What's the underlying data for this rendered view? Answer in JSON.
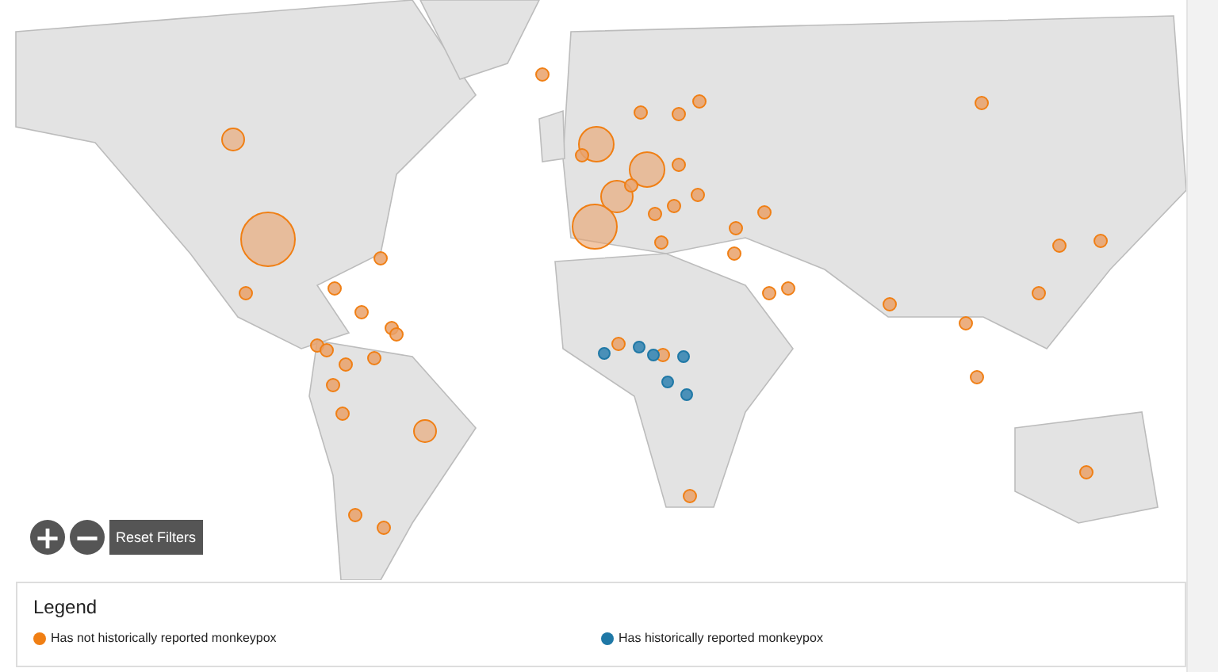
{
  "zoom_controls": [
    {
      "label": "+"
    },
    {
      "label": "−"
    }
  ],
  "reset_button": {
    "label": "Reset Filters"
  },
  "legend": {
    "title": "Legend",
    "items": [
      {
        "label": "Has not historically reported monkeypox",
        "color": "#f07f14"
      },
      {
        "label": "Has historically reported monkeypox",
        "color": "#1f78a6"
      }
    ]
  }
}
